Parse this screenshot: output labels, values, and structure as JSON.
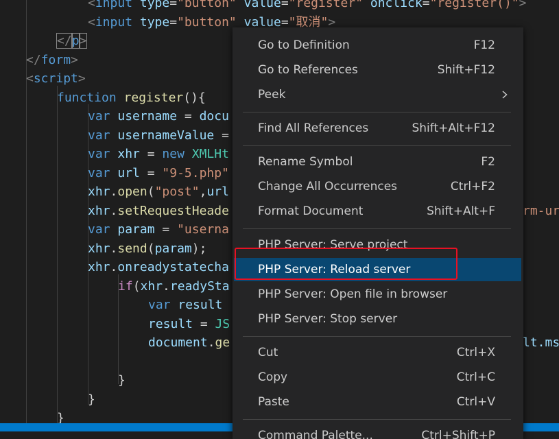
{
  "code_lines": [
    [
      {
        "t": "<",
        "c": "angle"
      },
      {
        "t": "input",
        "c": "tag"
      },
      {
        "t": " ",
        "c": "plain"
      },
      {
        "t": "type",
        "c": "attr"
      },
      {
        "t": "=",
        "c": "plain"
      },
      {
        "t": "\"button\"",
        "c": "str"
      },
      {
        "t": " ",
        "c": "plain"
      },
      {
        "t": "value",
        "c": "attr"
      },
      {
        "t": "=",
        "c": "plain"
      },
      {
        "t": "\"register\"",
        "c": "str"
      },
      {
        "t": " ",
        "c": "plain"
      },
      {
        "t": "onclick",
        "c": "attr"
      },
      {
        "t": "=",
        "c": "plain"
      },
      {
        "t": "\"register()\"",
        "c": "str"
      },
      {
        "t": ">",
        "c": "angle"
      }
    ],
    [
      {
        "t": "<",
        "c": "angle"
      },
      {
        "t": "input",
        "c": "tag"
      },
      {
        "t": " ",
        "c": "plain"
      },
      {
        "t": "type",
        "c": "attr"
      },
      {
        "t": "=",
        "c": "plain"
      },
      {
        "t": "\"button\"",
        "c": "str"
      },
      {
        "t": " ",
        "c": "plain"
      },
      {
        "t": "value",
        "c": "attr"
      },
      {
        "t": "=",
        "c": "plain"
      },
      {
        "t": "\"取消\"",
        "c": "str"
      },
      {
        "t": ">",
        "c": "angle"
      }
    ],
    [
      {
        "t": "</",
        "c": "angle"
      },
      {
        "t": "p",
        "c": "tag"
      },
      {
        "t": ">",
        "c": "angle"
      }
    ],
    [
      {
        "t": "</",
        "c": "angle"
      },
      {
        "t": "form",
        "c": "tag"
      },
      {
        "t": ">",
        "c": "angle"
      }
    ],
    [
      {
        "t": "<",
        "c": "angle"
      },
      {
        "t": "script",
        "c": "tag"
      },
      {
        "t": ">",
        "c": "angle"
      }
    ],
    [
      {
        "t": "function",
        "c": "kw"
      },
      {
        "t": " ",
        "c": "plain"
      },
      {
        "t": "register",
        "c": "fn"
      },
      {
        "t": "(){",
        "c": "plain"
      }
    ],
    [
      {
        "t": "var",
        "c": "kw"
      },
      {
        "t": " ",
        "c": "plain"
      },
      {
        "t": "username",
        "c": "var"
      },
      {
        "t": " = ",
        "c": "plain"
      },
      {
        "t": "docu",
        "c": "var"
      }
    ],
    [
      {
        "t": "var",
        "c": "kw"
      },
      {
        "t": " ",
        "c": "plain"
      },
      {
        "t": "usernameValue",
        "c": "var"
      },
      {
        "t": " =",
        "c": "plain"
      }
    ],
    [
      {
        "t": "var",
        "c": "kw"
      },
      {
        "t": " ",
        "c": "plain"
      },
      {
        "t": "xhr",
        "c": "var"
      },
      {
        "t": " = ",
        "c": "plain"
      },
      {
        "t": "new",
        "c": "kw"
      },
      {
        "t": " ",
        "c": "plain"
      },
      {
        "t": "XMLHt",
        "c": "cls"
      }
    ],
    [
      {
        "t": "var",
        "c": "kw"
      },
      {
        "t": " ",
        "c": "plain"
      },
      {
        "t": "url",
        "c": "var"
      },
      {
        "t": " = ",
        "c": "plain"
      },
      {
        "t": "\"9-5.php\"",
        "c": "str"
      }
    ],
    [
      {
        "t": "xhr",
        "c": "var"
      },
      {
        "t": ".",
        "c": "plain"
      },
      {
        "t": "open",
        "c": "fn"
      },
      {
        "t": "(",
        "c": "plain"
      },
      {
        "t": "\"post\"",
        "c": "str"
      },
      {
        "t": ",",
        "c": "plain"
      },
      {
        "t": "url",
        "c": "var"
      }
    ],
    [
      {
        "t": "xhr",
        "c": "var"
      },
      {
        "t": ".",
        "c": "plain"
      },
      {
        "t": "setRequestHeade",
        "c": "fn"
      }
    ],
    [
      {
        "t": "var",
        "c": "kw"
      },
      {
        "t": " ",
        "c": "plain"
      },
      {
        "t": "param",
        "c": "var"
      },
      {
        "t": " = ",
        "c": "plain"
      },
      {
        "t": "\"userna",
        "c": "str"
      }
    ],
    [
      {
        "t": "xhr",
        "c": "var"
      },
      {
        "t": ".",
        "c": "plain"
      },
      {
        "t": "send",
        "c": "fn"
      },
      {
        "t": "(",
        "c": "plain"
      },
      {
        "t": "param",
        "c": "var"
      },
      {
        "t": ");",
        "c": "plain"
      }
    ],
    [
      {
        "t": "xhr",
        "c": "var"
      },
      {
        "t": ".",
        "c": "plain"
      },
      {
        "t": "onreadystatecha",
        "c": "var"
      }
    ],
    [
      {
        "t": "if",
        "c": "ctl"
      },
      {
        "t": "(",
        "c": "plain"
      },
      {
        "t": "xhr",
        "c": "var"
      },
      {
        "t": ".",
        "c": "plain"
      },
      {
        "t": "readySta",
        "c": "var"
      }
    ],
    [
      {
        "t": "var",
        "c": "kw"
      },
      {
        "t": " ",
        "c": "plain"
      },
      {
        "t": "result",
        "c": "var"
      }
    ],
    [
      {
        "t": "result",
        "c": "var"
      },
      {
        "t": " = ",
        "c": "plain"
      },
      {
        "t": "JS",
        "c": "cls"
      }
    ],
    [
      {
        "t": "document",
        "c": "var"
      },
      {
        "t": ".",
        "c": "plain"
      },
      {
        "t": "ge",
        "c": "fn"
      }
    ],
    [],
    [
      {
        "t": "}",
        "c": "plain"
      }
    ],
    [
      {
        "t": "}",
        "c": "plain"
      }
    ],
    [
      {
        "t": "}",
        "c": "plain"
      }
    ]
  ],
  "code_tails": [
    {
      "text": "rm-ur",
      "color": "#ce9178"
    },
    {
      "text": "lt.ms",
      "color": "#9cdcfe"
    }
  ],
  "menu": {
    "items": [
      {
        "label": "Go to Definition",
        "shortcut": "F12"
      },
      {
        "label": "Go to References",
        "shortcut": "Shift+F12"
      },
      {
        "label": "Peek",
        "shortcut": "",
        "submenu": true
      },
      {
        "separator": true
      },
      {
        "label": "Find All References",
        "shortcut": "Shift+Alt+F12"
      },
      {
        "separator": true
      },
      {
        "label": "Rename Symbol",
        "shortcut": "F2"
      },
      {
        "label": "Change All Occurrences",
        "shortcut": "Ctrl+F2"
      },
      {
        "label": "Format Document",
        "shortcut": "Shift+Alt+F"
      },
      {
        "separator": true
      },
      {
        "label": "PHP Server: Serve project",
        "shortcut": ""
      },
      {
        "label": "PHP Server: Reload server",
        "shortcut": "",
        "active": true
      },
      {
        "label": "PHP Server: Open file in browser",
        "shortcut": ""
      },
      {
        "label": "PHP Server: Stop server",
        "shortcut": ""
      },
      {
        "separator": true
      },
      {
        "label": "Cut",
        "shortcut": "Ctrl+X"
      },
      {
        "label": "Copy",
        "shortcut": "Ctrl+C"
      },
      {
        "label": "Paste",
        "shortcut": "Ctrl+V"
      },
      {
        "separator": true
      },
      {
        "label": "Command Palette...",
        "shortcut": "Ctrl+Shift+P"
      }
    ]
  },
  "colors": {
    "editor_bg": "#1e1e1e",
    "menu_bg": "#252526",
    "menu_active": "#094771",
    "highlight_box": "#e81123",
    "statusbar": "#007acc"
  }
}
